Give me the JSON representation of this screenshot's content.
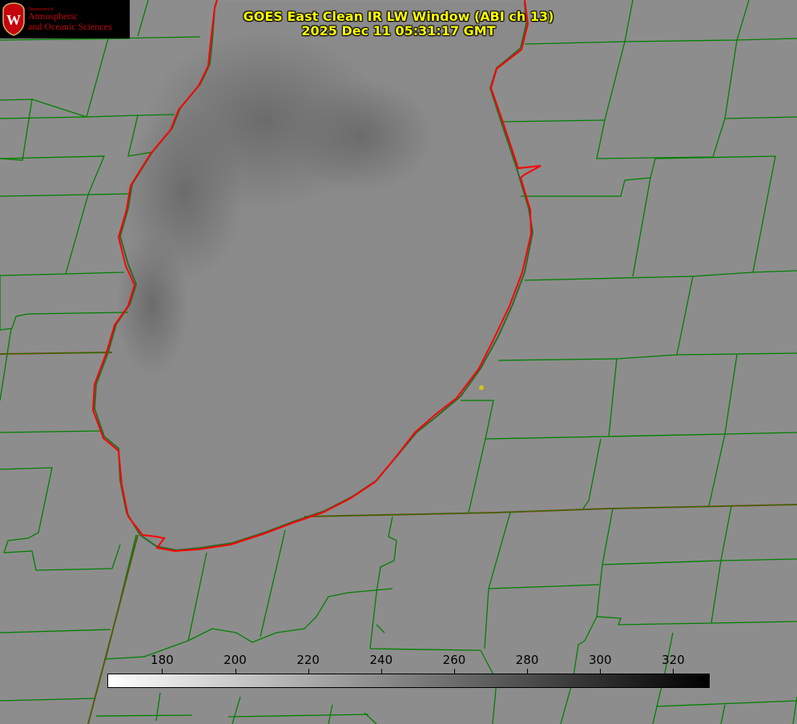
{
  "title": {
    "line1": "GOES East Clean IR LW Window (ABI ch 13)",
    "line2": "2025 Dec 11 05:31:17 GMT"
  },
  "logo": {
    "department": "Department of",
    "line1": "Atmospheric",
    "line2": "and Oceanic Sciences",
    "letter": "W"
  },
  "colorbar": {
    "ticks": [
      "180",
      "200",
      "220",
      "240",
      "260",
      "280",
      "300",
      "320"
    ],
    "tick_values": [
      180,
      200,
      220,
      240,
      260,
      280,
      300,
      320
    ],
    "range": [
      165,
      330
    ],
    "start_color": "#ffffff",
    "end_color": "#000000"
  },
  "colors": {
    "background": "#8d8d8d",
    "county_lines": "#008000",
    "state_lines": "#8b4513",
    "coastline": "#ff0000",
    "title": "#ffff00",
    "logo_accent": "#c5050c",
    "marker": "#d4c41a"
  }
}
